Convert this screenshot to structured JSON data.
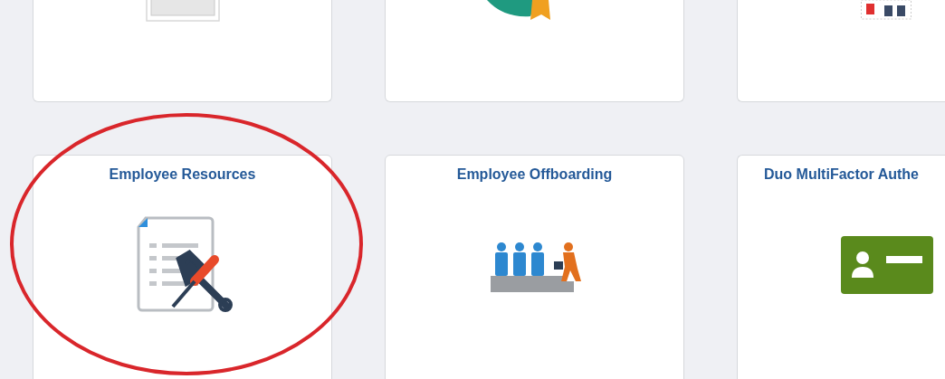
{
  "top_tiles": [
    {
      "kind": "form"
    },
    {
      "kind": "badge"
    },
    {
      "kind": "grid"
    }
  ],
  "tiles": [
    {
      "title": "Employee Resources",
      "kind": "document-tools"
    },
    {
      "title": "Employee Offboarding",
      "kind": "people"
    },
    {
      "title": "Duo MultiFactor Authe",
      "kind": "id-card"
    }
  ]
}
